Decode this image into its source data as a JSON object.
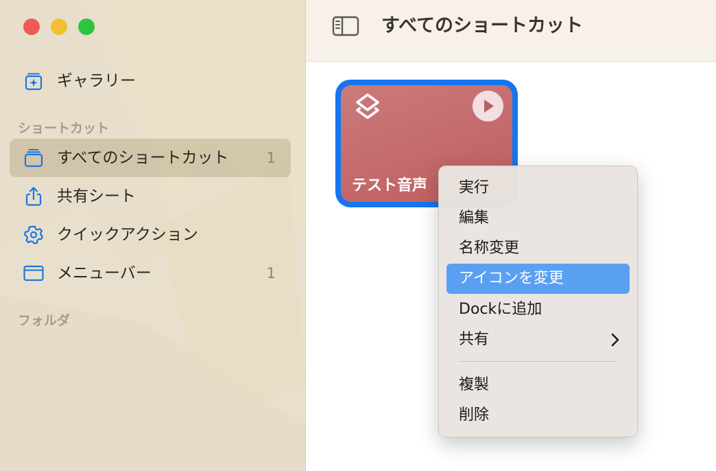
{
  "window": {
    "title": "すべてのショートカット",
    "traffic_lights": {
      "close": "#ee5a52",
      "minimize": "#f4bf2f",
      "zoom": "#2fc440"
    }
  },
  "sidebar": {
    "gallery": {
      "label": "ギャラリー",
      "icon": "gallery-icon"
    },
    "section_shortcuts": "ショートカット",
    "items": [
      {
        "label": "すべてのショートカット",
        "count": "1",
        "icon": "stack-icon",
        "selected": true
      },
      {
        "label": "共有シート",
        "count": "",
        "icon": "share-icon"
      },
      {
        "label": "クイックアクション",
        "count": "",
        "icon": "gear-icon"
      },
      {
        "label": "メニューバー",
        "count": "1",
        "icon": "menubar-icon"
      }
    ],
    "section_folders": "フォルダ"
  },
  "toolbar": {
    "title": "すべてのショートカット",
    "toggle_icon": "sidebar-toggle-icon"
  },
  "shortcut_card": {
    "title": "テスト音声",
    "color": "#c66c6e",
    "selection_color": "#1476f1",
    "icon": "shortcuts-icon",
    "play_icon": "play-icon"
  },
  "context_menu": {
    "items": [
      {
        "label": "実行"
      },
      {
        "label": "編集"
      },
      {
        "label": "名称変更"
      },
      {
        "label": "アイコンを変更",
        "highlighted": true
      },
      {
        "label": "Dockに追加"
      },
      {
        "label": "共有",
        "submenu": true
      },
      {
        "label": "複製"
      },
      {
        "label": "削除"
      }
    ],
    "highlight_color": "#5aa0f2"
  }
}
